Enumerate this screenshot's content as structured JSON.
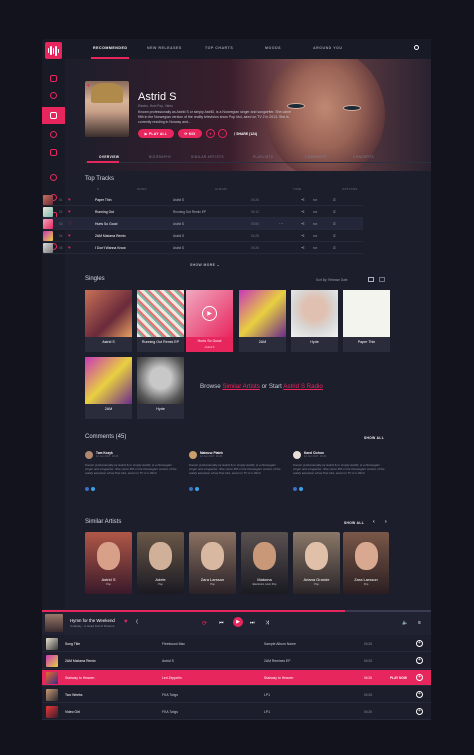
{
  "nav": {
    "tabs": [
      {
        "label": "RECOMMENDED",
        "active": true
      },
      {
        "label": "NEW RELEASES",
        "active": false
      },
      {
        "label": "TOP CHARTS",
        "active": false
      },
      {
        "label": "MOODS",
        "active": false
      },
      {
        "label": "AROUND YOU",
        "active": false
      }
    ]
  },
  "artist": {
    "name": "Astrid S",
    "genres": "Electro, Hom Pop, Video",
    "bio": "Known professionally as Astrid S or simply AstriD, is a Norwegian singer and songwriter. She came fifth in the Norwegian version of the reality television show Pop Idol, aired on TV 2 in 2013. She is currently residing in Norway and...",
    "play_all": "PLAY ALL",
    "mix": "MIX",
    "share": "SHARE (124)"
  },
  "subtabs": [
    "OVERVIEW",
    "BIOGRAPHY",
    "SIMILAR ARTISTS",
    "PLAYLISTS",
    "COMMENTS",
    "CONCERTS"
  ],
  "top_tracks": {
    "title": "Top Tracks",
    "headers": [
      "#",
      "SONG",
      "ALBUM",
      "TIME",
      "OPTIONS"
    ],
    "rows": [
      {
        "num": "01",
        "song": "Paper Thin",
        "album": "Astrid S",
        "time": "04:26"
      },
      {
        "num": "02",
        "song": "Running Out",
        "album": "Running Out Remix EP",
        "time": "04:12"
      },
      {
        "num": "03",
        "song": "Hurts So Good",
        "album": "Astrid S",
        "time": "03:50"
      },
      {
        "num": "04",
        "song": "2AM Matoma Remix",
        "album": "Astrid S",
        "time": "04:26"
      },
      {
        "num": "05",
        "song": "I Don't Wanna Know",
        "album": "Astrid S",
        "time": "04:26"
      }
    ],
    "show_more": "SHOW MORE"
  },
  "singles": {
    "title": "Singles",
    "sort": "Sort By: Release Date",
    "items": [
      {
        "title": "Astrid S",
        "sub": ""
      },
      {
        "title": "Running Out Remix EP",
        "sub": ""
      },
      {
        "title": "Hurts So Good",
        "sub": "Astrid S"
      },
      {
        "title": "2AM",
        "sub": ""
      },
      {
        "title": "Hyde",
        "sub": ""
      },
      {
        "title": "Paper Thin",
        "sub": ""
      },
      {
        "title": "2AM",
        "sub": ""
      },
      {
        "title": "Hyde",
        "sub": ""
      }
    ],
    "browse_prefix": "Browse",
    "browse_link1": "Similar Artists",
    "browse_mid": "or Start",
    "browse_link2": "Astrid S Radio"
  },
  "comments": {
    "title": "Comments (45)",
    "show_all": "SHOW ALL",
    "items": [
      {
        "name": "Tom Kozyk",
        "date": "12 Jun 2017, 10:20",
        "text": "Known professionally as Astrid S or simply AstriD, is a Norwegian singer and songwriter. She came fifth in the Norwegian version of the reality television show Pop Idol, aired on TV 2 in 2013."
      },
      {
        "name": "Mateusz Piatek",
        "date": "12 Jun 2017, 10:20",
        "text": "Known professionally as Astrid S or simply AstriD, is a Norwegian singer and songwriter. She came fifth in the Norwegian version of the reality television show Pop Idol, aired on TV 2 in 2013."
      },
      {
        "name": "Karol Cichon",
        "date": "12 Jun 2017, 10:20",
        "text": "Known professionally as Astrid S or simply AstriD, is a Norwegian singer and songwriter. She came fifth in the Norwegian version of the reality television show Pop Idol, aired on TV 2 in 2013."
      }
    ]
  },
  "similar": {
    "title": "Similar Artists",
    "show_all": "SHOW ALL",
    "items": [
      {
        "name": "Astrid S",
        "genre": "Pop"
      },
      {
        "name": "Adele",
        "genre": "Pop"
      },
      {
        "name": "Zara Larsson",
        "genre": "Pop"
      },
      {
        "name": "Matoma",
        "genre": "Electronic, Hom Pop"
      },
      {
        "name": "Ariana Grande",
        "genre": "Pop"
      },
      {
        "name": "Zara Larsson",
        "genre": "Pop"
      }
    ]
  },
  "player": {
    "title": "Hymn for the Weekend",
    "subtitle": "Coldplay - A Head Full of Dreams"
  },
  "queue": [
    {
      "song": "Song Title",
      "artist": "Fleetwood Mac",
      "album": "Sample Album Name",
      "dur": "04:26",
      "active": false
    },
    {
      "song": "2AM Matoma Remix",
      "artist": "Astrid S",
      "album": "2AM Remixes EP",
      "dur": "04:26",
      "active": false
    },
    {
      "song": "Stairway to Heaven",
      "artist": "Led Zeppelin",
      "album": "Stairway to Heaven",
      "dur": "04:26",
      "active": true,
      "play_now": "PLAY NOW"
    },
    {
      "song": "Two Weeks",
      "artist": "FKA Twigs",
      "album": "LP1",
      "dur": "04:26",
      "active": false
    },
    {
      "song": "Video Girl",
      "artist": "FKA Twigs",
      "album": "LP1",
      "dur": "04:26",
      "active": false
    }
  ],
  "colors": {
    "accent": "#e8265e",
    "background": "#1c1e2b",
    "sidebar": "#181a26"
  }
}
